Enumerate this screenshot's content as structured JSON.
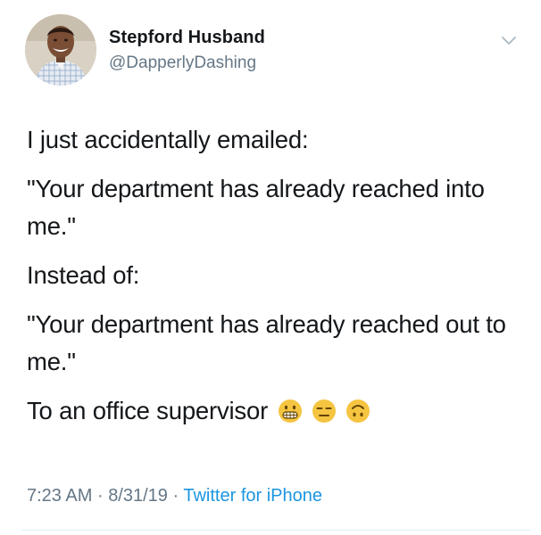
{
  "author": {
    "display_name": "Stepford Husband",
    "handle": "@DapperlyDashing",
    "avatar_icon": "profile-photo"
  },
  "menu": {
    "icon": "chevron-down-icon"
  },
  "tweet": {
    "paragraphs": [
      "I just accidentally emailed:",
      "\"Your department has already reached into me.\"",
      "Instead of:",
      "\"Your department has already reached out to me.\""
    ],
    "closing_text": "To an office supervisor",
    "emojis": [
      "grimacing-face-icon",
      "expressionless-face-icon",
      "upside-down-face-icon"
    ]
  },
  "meta": {
    "time": "7:23 AM",
    "separator": "·",
    "date": "8/31/19",
    "source": "Twitter for iPhone"
  },
  "colors": {
    "text": "#14171a",
    "secondary": "#657786",
    "link": "#1b95e0",
    "emoji_yellow": "#f5c542"
  }
}
